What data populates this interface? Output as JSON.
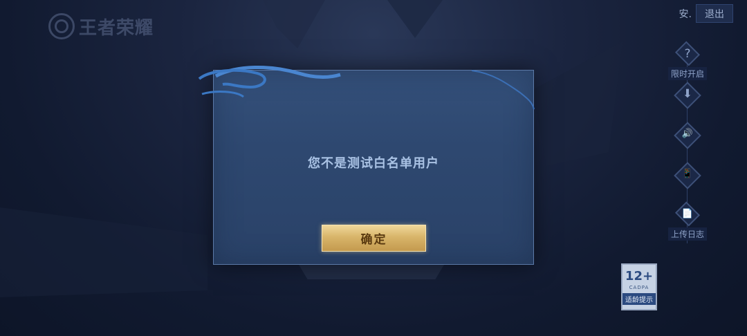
{
  "logo": {
    "text": "王者荣耀"
  },
  "header": {
    "account_text": "安.",
    "logout_label": "退出"
  },
  "side_tools": [
    {
      "icon": "question-icon",
      "glyph": "?",
      "label": "限时开启"
    },
    {
      "icon": "download-icon",
      "glyph": "⬇",
      "label": ""
    },
    {
      "icon": "speaker-icon",
      "glyph": "🔊",
      "label": ""
    },
    {
      "icon": "phone-icon",
      "glyph": "📱",
      "label": ""
    },
    {
      "icon": "log-upload-icon",
      "glyph": "📄",
      "label": "上传日志"
    }
  ],
  "dialog": {
    "message": "您不是测试白名单用户",
    "confirm_label": "确定"
  },
  "age_badge": {
    "rating": "12+",
    "org": "CADPA",
    "tip": "适龄提示"
  },
  "colors": {
    "dialog_bg": "#2e4870",
    "confirm_gold": "#d8b56a",
    "text_blue": "#a9c2e4"
  }
}
